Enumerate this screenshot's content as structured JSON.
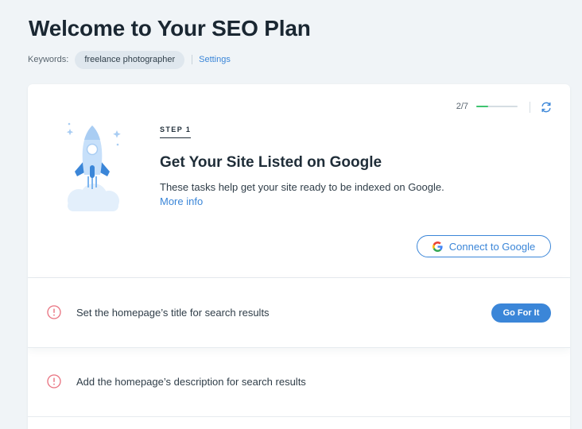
{
  "header": {
    "title": "Welcome to Your SEO Plan",
    "keywords_label": "Keywords:",
    "keyword_chip": "freelance photographer",
    "settings_link": "Settings"
  },
  "progress": {
    "text": "2/7",
    "fraction": 0.2857,
    "fill_color": "#3fc470"
  },
  "step": {
    "label": "STEP 1",
    "title": "Get Your Site Listed on Google",
    "description": "These tasks help get your site ready to be indexed on Google.",
    "more_info": "More info",
    "connect_button": "Connect to Google",
    "illustration": "rocket-illustration"
  },
  "tasks": [
    {
      "text": "Set the homepage’s title for search results",
      "action": "Go For It",
      "icon": "alert-circle-icon"
    },
    {
      "text": "Add the homepage’s description for search results",
      "icon": "alert-circle-icon"
    }
  ],
  "colors": {
    "accent": "#3b86d8",
    "alert": "#e8707e",
    "background": "#f0f4f7"
  }
}
